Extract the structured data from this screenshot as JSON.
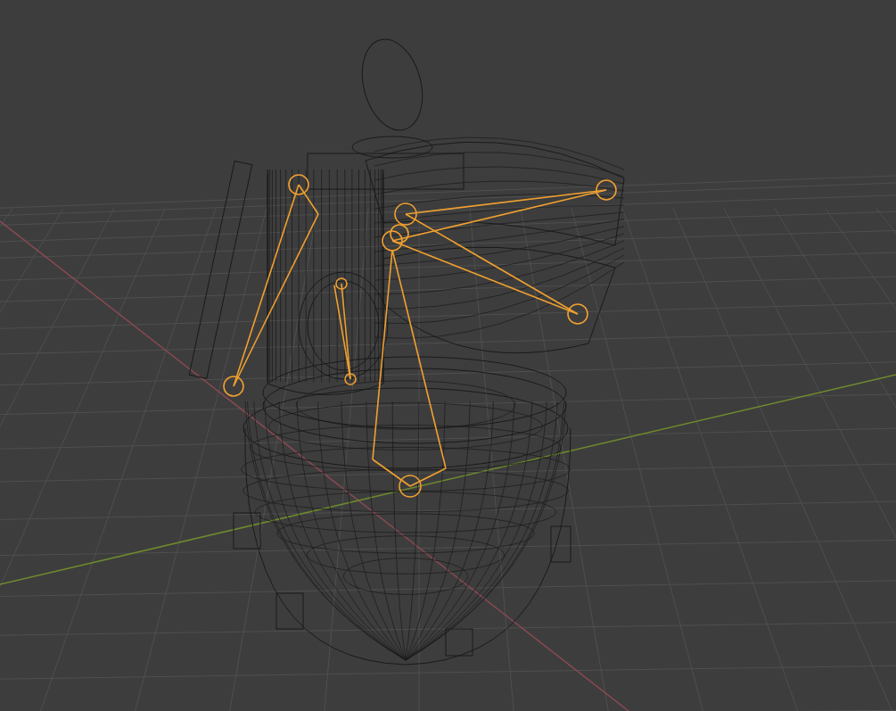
{
  "viewport": {
    "wireframe": true,
    "show_floor": true,
    "show_axes": true
  },
  "armature": {
    "selected": true
  }
}
